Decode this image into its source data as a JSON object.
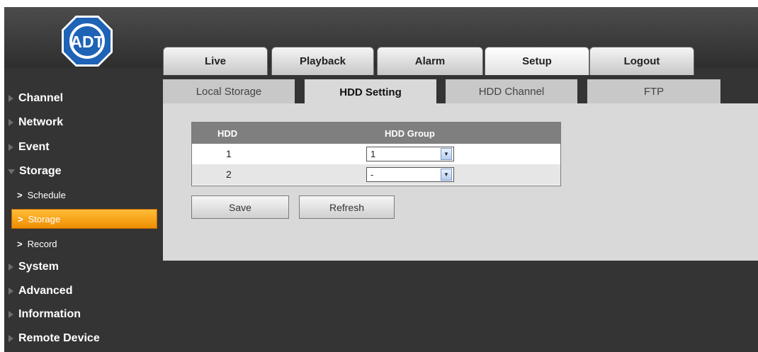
{
  "brand": {
    "logo_text": "ADT"
  },
  "main_tabs": [
    {
      "label": "Live"
    },
    {
      "label": "Playback"
    },
    {
      "label": "Alarm"
    },
    {
      "label": "Setup"
    },
    {
      "label": "Logout"
    }
  ],
  "active_main_tab": "Setup",
  "sidebar": {
    "items": [
      {
        "label": "Channel"
      },
      {
        "label": "Network"
      },
      {
        "label": "Event"
      },
      {
        "label": "Storage",
        "expanded": true
      },
      {
        "label": "System"
      },
      {
        "label": "Advanced"
      },
      {
        "label": "Information"
      },
      {
        "label": "Remote Device"
      }
    ],
    "storage_subitems": [
      {
        "label": "Schedule"
      },
      {
        "label": "Storage",
        "active": true
      },
      {
        "label": "Record"
      }
    ],
    "sub_chevron": ">"
  },
  "sub_tabs": [
    {
      "label": "Local Storage"
    },
    {
      "label": "HDD Setting"
    },
    {
      "label": "HDD Channel"
    },
    {
      "label": "FTP"
    }
  ],
  "active_sub_tab": "HDD Setting",
  "hdd_table": {
    "headers": {
      "hdd": "HDD",
      "group": "HDD Group"
    },
    "rows": [
      {
        "hdd": "1",
        "group": "1"
      },
      {
        "hdd": "2",
        "group": "-"
      }
    ]
  },
  "buttons": {
    "save": "Save",
    "refresh": "Refresh"
  },
  "colors": {
    "background": "#343434",
    "active_nav": "#f5a623",
    "content_panel": "#d9d9d9",
    "table_header": "#7f7f7f",
    "logo_blue": "#1e63b6"
  }
}
